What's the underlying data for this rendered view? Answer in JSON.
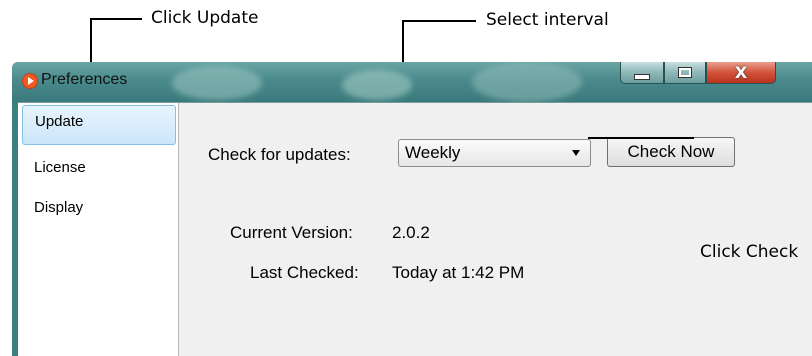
{
  "callouts": {
    "click_update": "Click Update",
    "select_interval": "Select interval",
    "click_check": "Click Check"
  },
  "window": {
    "title": "Preferences",
    "icon": "app-play-icon",
    "controls": {
      "minimize": "minimize-icon",
      "maximize": "maximize-icon",
      "close": "close-icon"
    }
  },
  "sidebar": {
    "items": [
      {
        "label": "Update",
        "selected": true
      },
      {
        "label": "License",
        "selected": false
      },
      {
        "label": "Display",
        "selected": false
      }
    ]
  },
  "update": {
    "check_label": "Check for updates:",
    "interval_value": "Weekly",
    "check_now_label": "Check Now",
    "current_version_label": "Current Version:",
    "current_version_value": "2.0.2",
    "last_checked_label": "Last Checked:",
    "last_checked_value": "Today at 1:42 PM"
  },
  "colors": {
    "titlebar": "#4a8a8c",
    "selection": "#cbe6fb",
    "close_button": "#d2533a"
  }
}
